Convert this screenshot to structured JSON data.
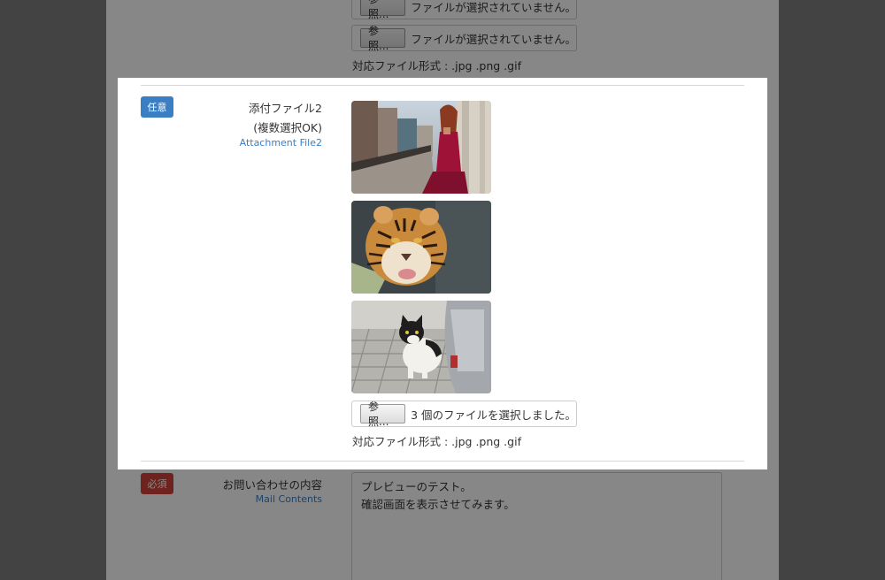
{
  "top_section": {
    "file_rows": [
      {
        "browse_label": "参照...",
        "status": "ファイルが選択されていません。"
      },
      {
        "browse_label": "参照...",
        "status": "ファイルが選択されていません。"
      }
    ],
    "formats_text": "対応ファイル形式 : .jpg .png .gif"
  },
  "attachment_section": {
    "badge": "任意",
    "label_jp": "添付ファイル2",
    "label_sub": "(複数選択OK)",
    "label_en": "Attachment File2",
    "thumbnails": [
      {
        "icon": "photo-woman-icon"
      },
      {
        "icon": "photo-tiger-icon"
      },
      {
        "icon": "photo-cat-icon"
      }
    ],
    "browse_label": "参照...",
    "file_status": "3 個のファイルを選択しました。",
    "formats_text": "対応ファイル形式 : .jpg .png .gif"
  },
  "contents_section": {
    "badge": "必須",
    "label_jp": "お問い合わせの内容",
    "label_en": "Mail Contents",
    "textarea_lines": [
      "プレビューのテスト。",
      "確認画面を表示させてみます。"
    ]
  },
  "colors": {
    "optional_badge": "#3a7fc4",
    "required_badge": "#d0423b",
    "english_label": "#3a7fc4"
  }
}
